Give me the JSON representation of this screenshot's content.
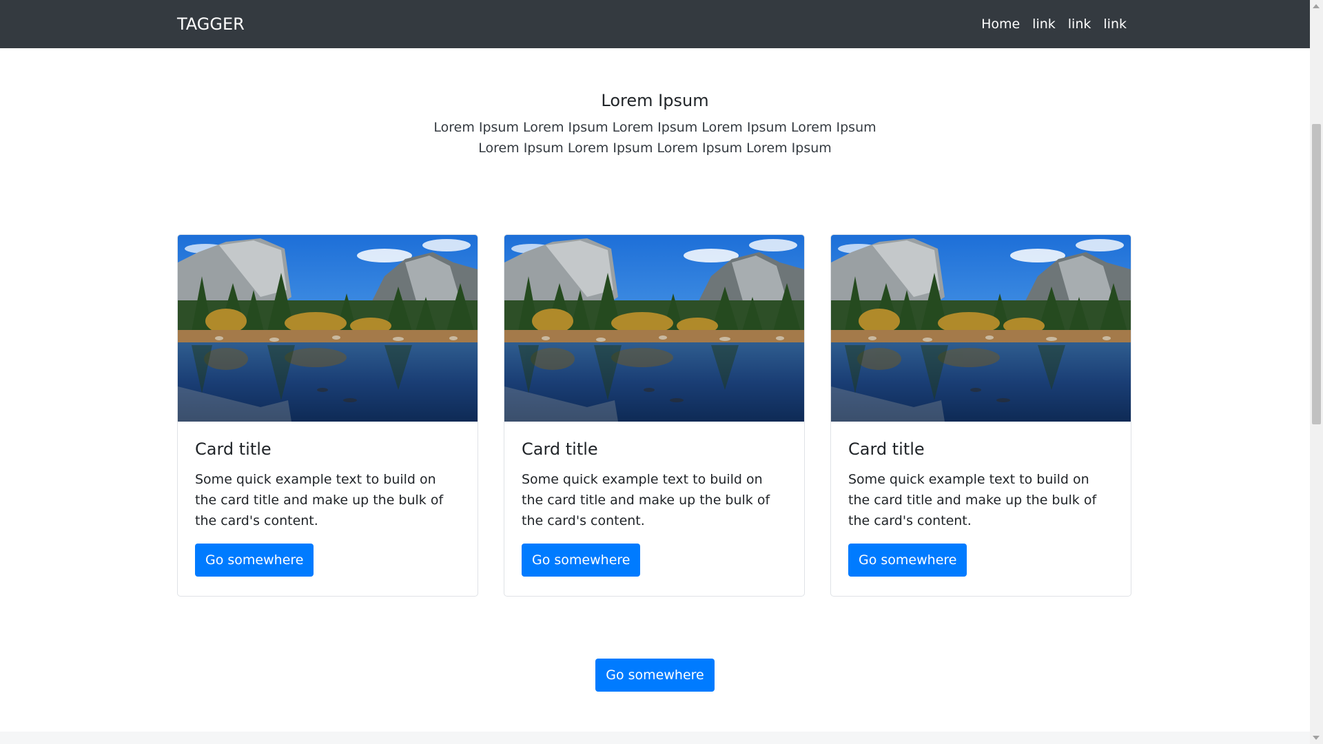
{
  "navbar": {
    "brand": "TAGGER",
    "links": [
      "Home",
      "link",
      "link",
      "link"
    ]
  },
  "hero": {
    "title": "Lorem Ipsum",
    "text": "Lorem Ipsum Lorem Ipsum Lorem Ipsum Lorem Ipsum Lorem Ipsum Lorem Ipsum Lorem Ipsum Lorem Ipsum Lorem Ipsum"
  },
  "cards": [
    {
      "title": "Card title",
      "text": "Some quick example text to build on the card title and make up the bulk of the card's content.",
      "button": "Go somewhere",
      "image_icon": "landscape-photo-icon"
    },
    {
      "title": "Card title",
      "text": "Some quick example text to build on the card title and make up the bulk of the card's content.",
      "button": "Go somewhere",
      "image_icon": "landscape-photo-icon"
    },
    {
      "title": "Card title",
      "text": "Some quick example text to build on the card title and make up the bulk of the card's content.",
      "button": "Go somewhere",
      "image_icon": "landscape-photo-icon"
    }
  ],
  "bottom_button": "Go somewhere",
  "colors": {
    "navbar": "#343a40",
    "primary": "#007bff",
    "text": "#212529"
  }
}
